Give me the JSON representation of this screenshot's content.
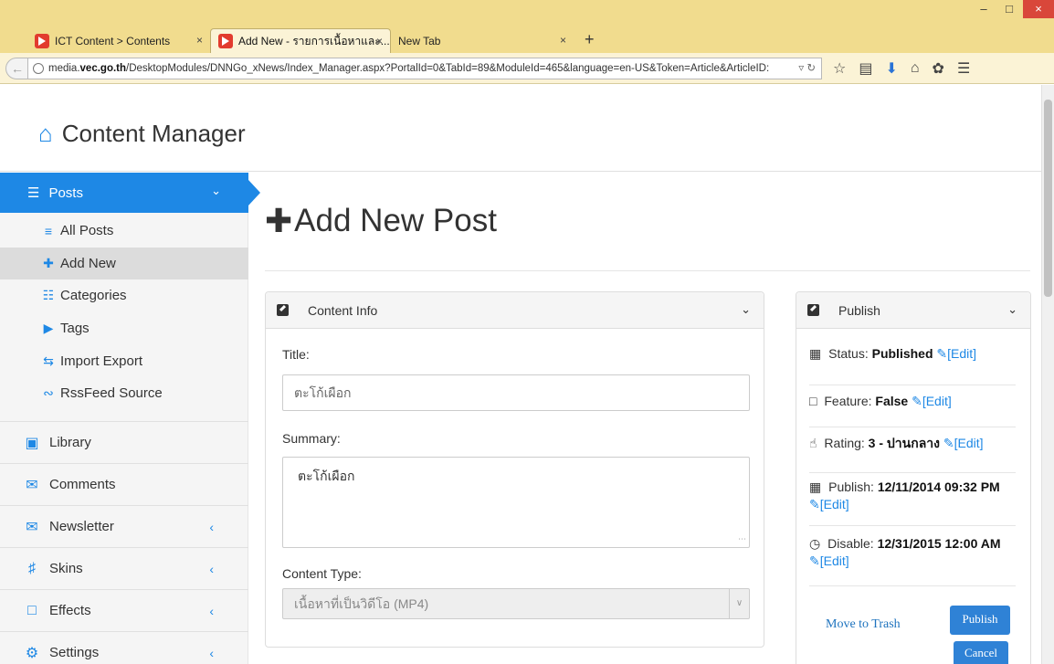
{
  "browser": {
    "tabs": [
      {
        "label": "ICT Content > Contents",
        "close": "×"
      },
      {
        "label": "Add New - รายการเนื้อหาและ...",
        "close": "×"
      },
      {
        "label": "New Tab",
        "close": "×"
      }
    ],
    "new_tab": "+",
    "url_prefix": "media.",
    "url_domain": "vec.go.th",
    "url_path": "/DesktopModules/DNNGo_xNews/Index_Manager.aspx?PortalId=0&TabId=89&ModuleId=465&language=en-US&Token=Article&ArticleID:",
    "window_controls": {
      "minimize": "–",
      "maximize": "□",
      "close": "×"
    }
  },
  "header": {
    "title": "Content Manager"
  },
  "sidebar": {
    "active": {
      "label": "Posts"
    },
    "sub_items": [
      {
        "label": "All Posts",
        "icon": "list-icon"
      },
      {
        "label": "Add New",
        "icon": "plus-icon"
      },
      {
        "label": "Categories",
        "icon": "sitemap-icon"
      },
      {
        "label": "Tags",
        "icon": "tag-icon"
      },
      {
        "label": "Import Export",
        "icon": "retweet-icon"
      },
      {
        "label": "RssFeed Source",
        "icon": "rss-icon"
      }
    ],
    "items": [
      {
        "label": "Library",
        "icon": "image-icon"
      },
      {
        "label": "Comments",
        "icon": "comments-icon"
      },
      {
        "label": "Newsletter",
        "icon": "envelope-icon"
      },
      {
        "label": "Skins",
        "icon": "shirt-icon"
      },
      {
        "label": "Effects",
        "icon": "bookmark-icon"
      },
      {
        "label": "Settings",
        "icon": "gear-icon"
      }
    ]
  },
  "main": {
    "heading": "Add New Post",
    "content_info": {
      "title": "Content Info",
      "title_label": "Title:",
      "title_value": "ตะโก้เผือก",
      "summary_label": "Summary:",
      "summary_value": "ตะโก้เผือก",
      "content_type_label": "Content Type:",
      "content_type_value": "เนื้อหาที่เป็นวิดีโอ (MP4)"
    },
    "publish": {
      "title": "Publish",
      "status_label": "Status:",
      "status_value": "Published",
      "feature_label": "Feature:",
      "feature_value": "False",
      "rating_label": "Rating:",
      "rating_value": "3 - ปานกลาง",
      "publish_label": "Publish:",
      "publish_value": "12/11/2014 09:32 PM",
      "disable_label": "Disable:",
      "disable_value": "12/31/2015 12:00 AM",
      "edit_link": "[Edit]",
      "move_to_trash": "Move to Trash",
      "publish_button": "Publish",
      "cancel_button": "Cancel"
    }
  }
}
